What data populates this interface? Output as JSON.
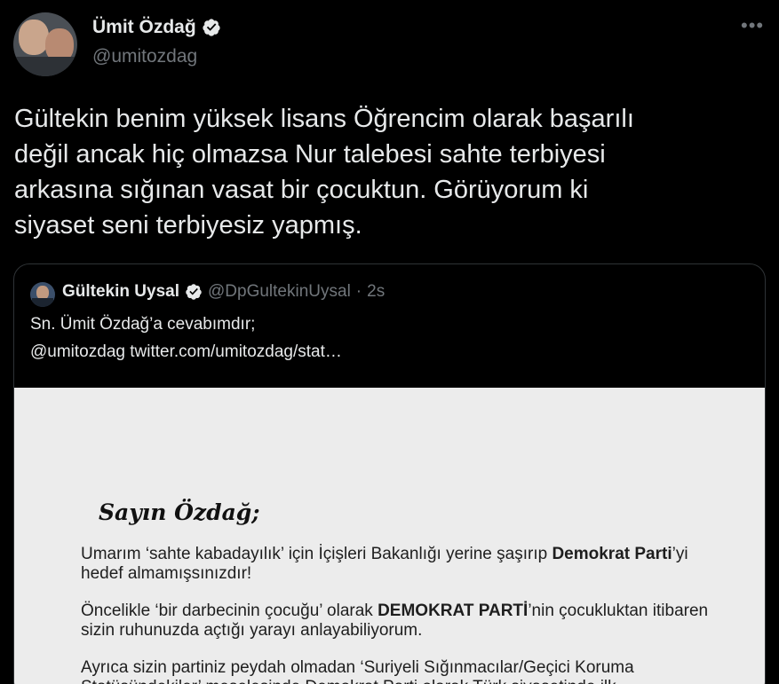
{
  "tweet": {
    "display_name": "Ümit Özdağ",
    "handle": "@umitozdag",
    "text": "Gültekin benim yüksek lisans Öğrencim olarak başarılı\ndeğil ancak hiç olmazsa Nur talebesi sahte terbiyesi\narkasına sığınan vasat bir çocuktun. Görüyorum ki\nsiyaset seni terbiyesiz yapmış.",
    "more_icon": "more-horizontal-icon"
  },
  "quote": {
    "display_name": "Gültekin Uysal",
    "handle": "@DpGultekinUysal",
    "separator": "·",
    "time": "2s",
    "text": "Sn. Ümit Özdağ’a cevabımdır;\n@umitozdag  twitter.com/umitozdag/stat…"
  },
  "letter": {
    "salutation": "Sayın Özdağ;",
    "p1_a": "Umarım ‘sahte kabadayılık’ için İçişleri Bakanlığı yerine şaşırıp ",
    "p1_b": "Demokrat Parti",
    "p1_c": "’yi hedef almamışsınızdır!",
    "p2_a": "Öncelikle ‘bir darbecinin çocuğu’ olarak ",
    "p2_b": "DEMOKRAT PARTİ",
    "p2_c": "’nin çocukluktan itibaren sizin ruhunuzda açtığı yarayı anlayabiliyorum.",
    "p3": "Ayrıca sizin partiniz peydah olmadan ‘Suriyeli Sığınmacılar/Geçici Koruma Statüsündekiler’ meselesinde Demokrat Parti olarak Türk siyasetinde ilk"
  },
  "colors": {
    "background": "#000000",
    "text": "#e7e9ea",
    "secondary": "#71767b",
    "border": "#2f3336",
    "verified_badge": "#e7e9ea"
  }
}
